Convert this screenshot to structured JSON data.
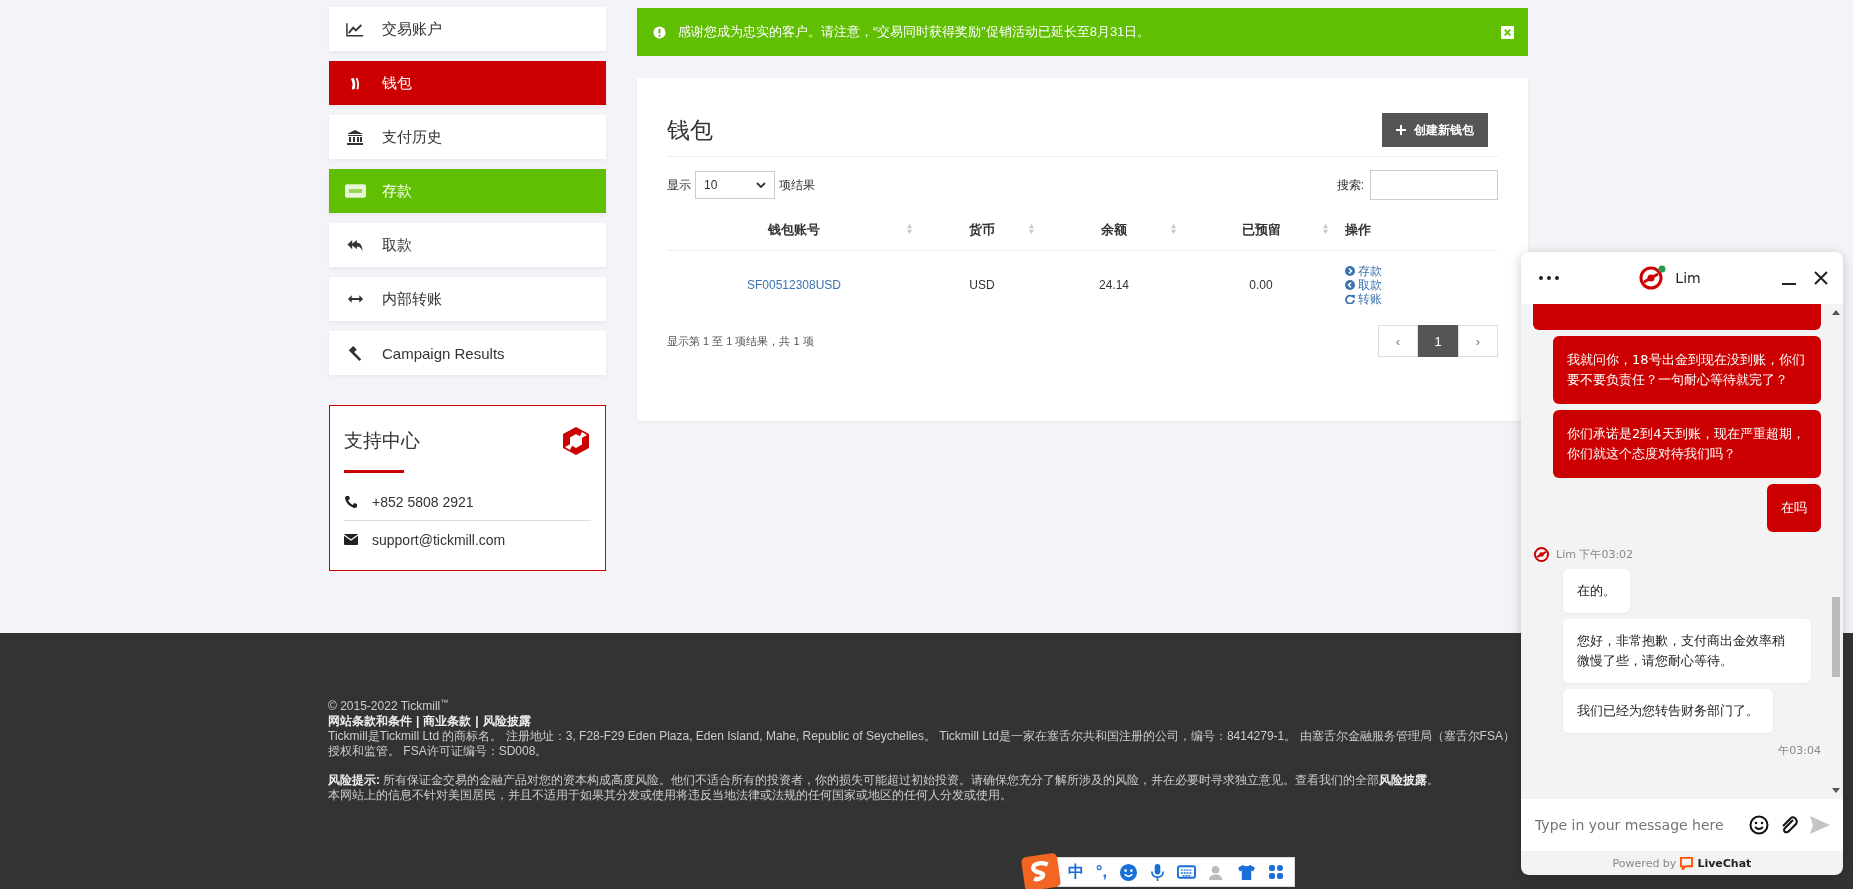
{
  "sidebar": {
    "items": [
      {
        "label": "交易账户",
        "selected": false,
        "highlight": false
      },
      {
        "label": "钱包",
        "selected": true,
        "highlight": false
      },
      {
        "label": "支付历史",
        "selected": false,
        "highlight": false
      },
      {
        "label": "存款",
        "selected": false,
        "highlight": true
      },
      {
        "label": "取款",
        "selected": false,
        "highlight": false
      },
      {
        "label": "内部转账",
        "selected": false,
        "highlight": false
      },
      {
        "label": "Campaign Results",
        "selected": false,
        "highlight": false
      }
    ],
    "support": {
      "title": "支持中心",
      "phone": "+852 5808 2921",
      "email": "support@tickmill.com"
    }
  },
  "alert": {
    "text": "感谢您成为忠实的客户。请注意，“交易同时获得奖励”促销活动已延长至8月31日。"
  },
  "wallet": {
    "title": "钱包",
    "create_button": "创建新钱包",
    "show_label": "显示",
    "page_size": "10",
    "results_label": "项结果",
    "search_label": "搜索:",
    "columns": [
      {
        "label": "钱包账号",
        "sortable": true
      },
      {
        "label": "货币",
        "sortable": true
      },
      {
        "label": "余额",
        "sortable": true
      },
      {
        "label": "已预留",
        "sortable": true
      },
      {
        "label": "操作",
        "sortable": false
      }
    ],
    "rows": [
      {
        "account": "SF00512308USD",
        "currency": "USD",
        "balance": "24.14",
        "reserved": "0.00",
        "actions": [
          "存款",
          "取款",
          "转账"
        ]
      }
    ],
    "info": "显示第 1 至 1 项结果，共 1 项",
    "pagination": {
      "prev": "‹",
      "pages": [
        {
          "label": "1",
          "selected": true
        }
      ],
      "next": "›"
    }
  },
  "chat": {
    "agent": "Lim",
    "messages": [
      {
        "kind": "partial"
      },
      {
        "kind": "visitor",
        "text": "我就问你，18号出金到现在没到账，你们要不要负责任？一句耐心等待就完了？"
      },
      {
        "kind": "visitor",
        "text": "你们承诺是2到4天到账，现在严重超期，你们就这个态度对待我们吗？"
      },
      {
        "kind": "visitor",
        "text": "在吗"
      },
      {
        "kind": "agent_meta",
        "text": "Lim 下午03:02"
      },
      {
        "kind": "agent",
        "text": "在的。"
      },
      {
        "kind": "agent",
        "text": "您好，非常抱歉，支付商出金效率稍微慢了些，请您耐心等待。"
      },
      {
        "kind": "agent",
        "text": "我们已经为您转告财务部门了。"
      },
      {
        "kind": "visitor_meta",
        "text": "午03:04"
      }
    ],
    "placeholder": "Type in your message here",
    "powered": "Powered by",
    "brand": "LiveChat"
  },
  "footer": {
    "copyright": "© 2015-2022 Tickmill$^{™}$",
    "links": [
      "网站条款和条件",
      "商业条款",
      "风险披露"
    ],
    "separator": "|",
    "company": "Tickmill是Tickmill Ltd 的商标名。 注册地址：3, F28-F29 Eden Plaza, Eden Island, Mahe, Republic of Seychelles。 Tickmill Ltd是一家在塞舌尔共和国注册的公司，编号：8414279-1。 由塞舌尔金融服务管理局（塞舌尔FSA）授权和监管。 FSA许可证编号：SD008。",
    "risk": "**风险提示:** 所有保证金交易的金融产品对您的资本构成高度风险。他们不适合所有的投资者，你的损失可能超过初始投资。请确保您充分了解所涉及的风险，并在必要时寻求独立意见。查看我们的全部**风险披露**。",
    "notice": "本网站上的信息不针对美国居民，并且不适用于如果其分发或使用将违反当地法律或法规的任何国家或地区的任何人分发或使用。"
  },
  "ime": {
    "items": [
      "中",
      "°,"
    ]
  }
}
